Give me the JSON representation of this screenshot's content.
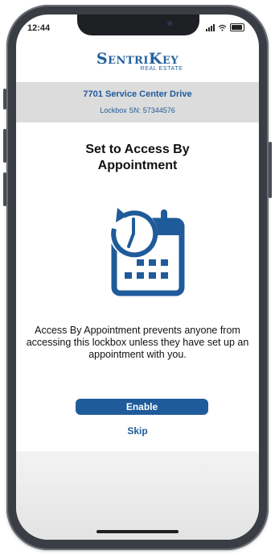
{
  "status_bar": {
    "time": "12:44"
  },
  "header": {
    "logo_main": "SentriKey",
    "logo_sub": "REAL ESTATE",
    "address": "7701 Service Center Drive",
    "lockbox_sn": "Lockbox SN: 57344576"
  },
  "main": {
    "title_line1": "Set to Access By",
    "title_line2": "Appointment",
    "description": "Access By Appointment prevents anyone from accessing this lockbox unless they have set up an appointment with you.",
    "enable_label": "Enable",
    "skip_label": "Skip"
  },
  "colors": {
    "brand_blue": "#1f5b9a",
    "band_gray": "#dcdcdc"
  },
  "icons": {
    "hero": "calendar-clock-icon"
  }
}
